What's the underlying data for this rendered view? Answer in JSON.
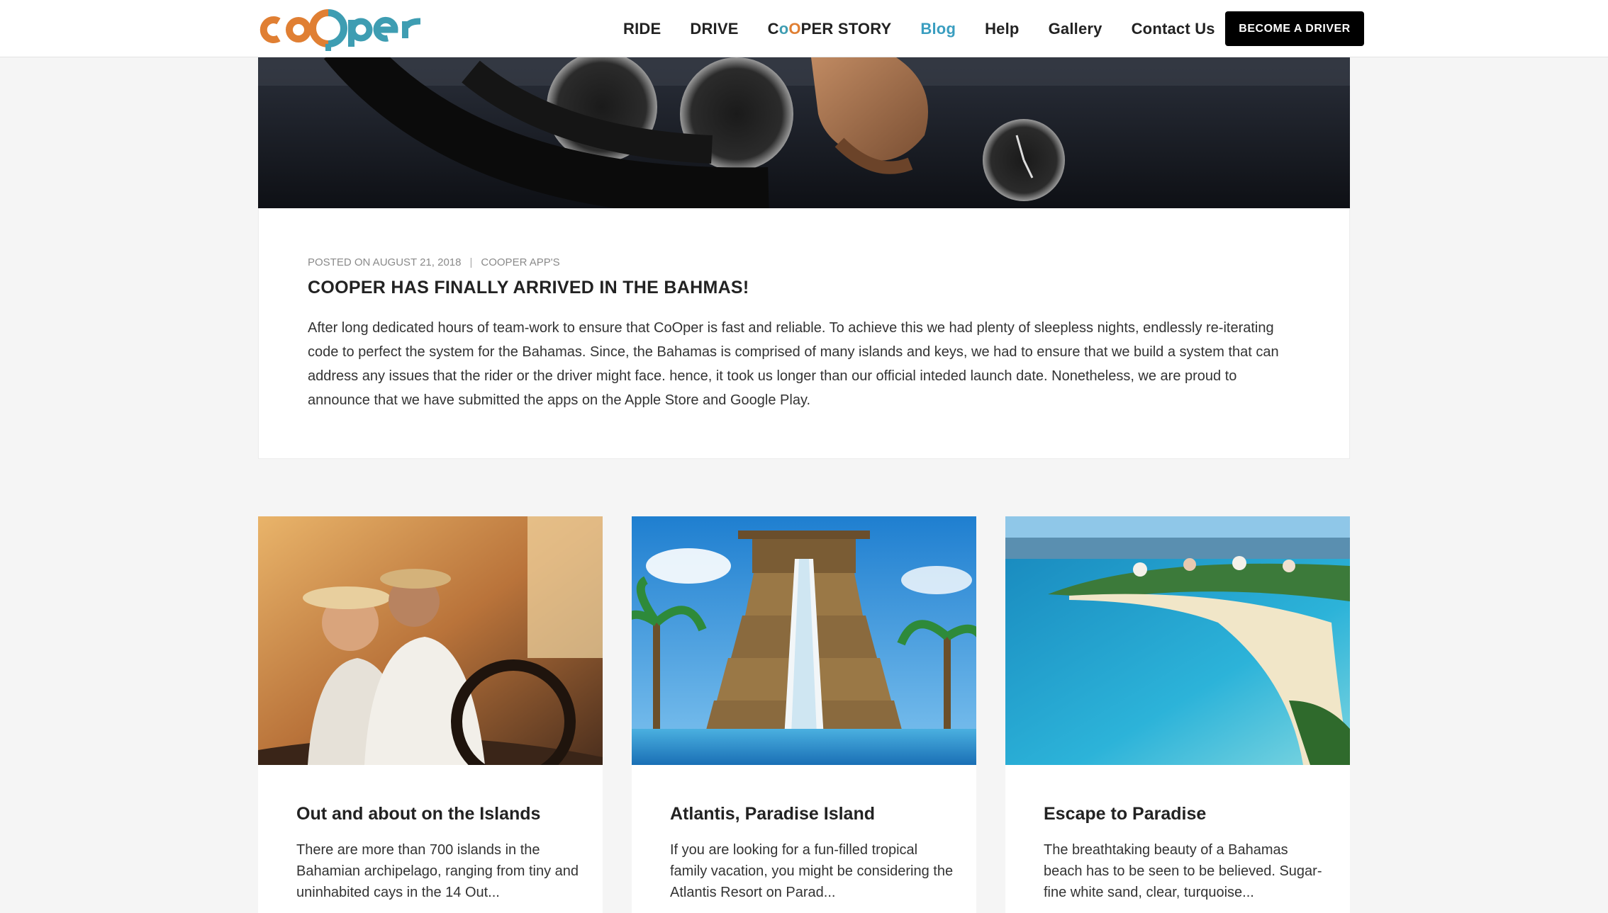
{
  "header": {
    "logo_text": "coOper",
    "nav": {
      "ride": "RIDE",
      "drive": "DRIVE",
      "story_prefix": "C",
      "story_o1": "o",
      "story_o2": "O",
      "story_suffix": "PER STORY",
      "blog": "Blog",
      "help": "Help",
      "gallery": "Gallery",
      "contact": "Contact Us"
    },
    "cta": "BECOME A DRIVER"
  },
  "featured": {
    "meta_date": "POSTED ON AUGUST 21, 2018",
    "meta_sep": "|",
    "meta_category": "COOPER APP'S",
    "title": "COOPER HAS FINALLY ARRIVED IN THE BAHMAS!",
    "body": "After long dedicated hours of team-work to ensure that CoOper is fast and reliable. To achieve this we had plenty of sleepless nights, endlessly re-iterating code to perfect the system for the Bahamas. Since, the Bahamas is comprised of many islands and keys, we had to ensure that we build a system that can address any issues that the rider or the driver might face. hence, it took us longer than our official inteded launch date. Nonetheless, we are proud to announce that we have submitted the apps on the Apple Store and Google Play."
  },
  "cards": [
    {
      "title": "Out and about on the Islands",
      "excerpt": "There are more than 700 islands in the Bahamian archipelago, ranging from tiny and uninhabited cays in the 14 Out..."
    },
    {
      "title": "Atlantis, Paradise Island",
      "excerpt": "If you are looking for a fun-filled tropical family vacation, you might be considering the Atlantis Resort on Parad..."
    },
    {
      "title": "Escape to Paradise",
      "excerpt": "The breathtaking beauty of a Bahamas beach has to be seen to be believed. Sugar-fine white sand, clear, turquoise..."
    }
  ],
  "colors": {
    "brand_orange": "#e07f33",
    "brand_teal": "#3e9db2",
    "nav_active": "#3a9ec0",
    "cta_bg": "#000000"
  }
}
